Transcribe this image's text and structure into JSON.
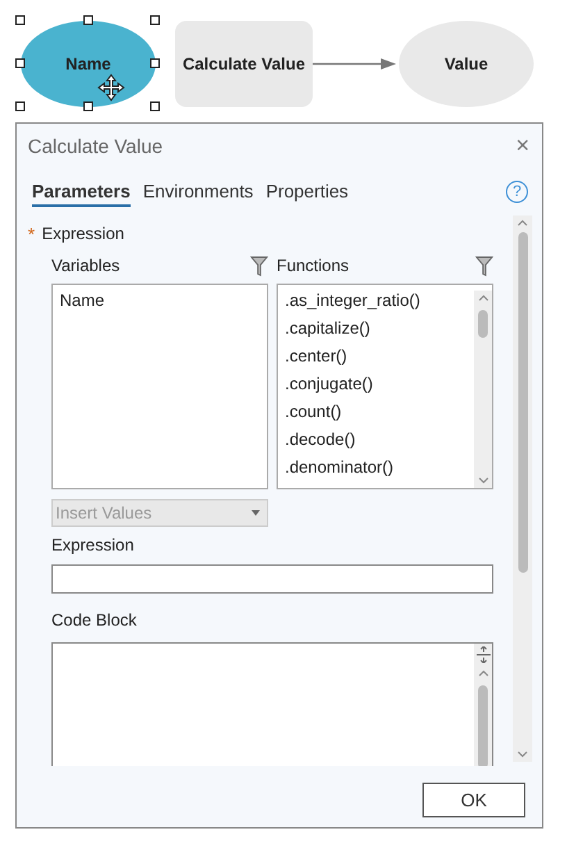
{
  "diagram": {
    "nodes": [
      {
        "kind": "variable",
        "label": "Name",
        "selected": true
      },
      {
        "kind": "tool",
        "label": "Calculate Value",
        "selected": false
      },
      {
        "kind": "variable",
        "label": "Value",
        "selected": false
      }
    ]
  },
  "dialog": {
    "title": "Calculate Value",
    "close": "×",
    "tabs": [
      {
        "label": "Parameters",
        "selected": true
      },
      {
        "label": "Environments",
        "selected": false
      },
      {
        "label": "Properties",
        "selected": false
      }
    ],
    "help": "?",
    "expression_param": {
      "label": "Expression",
      "required": true,
      "required_mark": "*"
    },
    "variables": {
      "label": "Variables",
      "items": [
        "Name"
      ]
    },
    "functions": {
      "label": "Functions",
      "items": [
        ".as_integer_ratio()",
        ".capitalize()",
        ".center()",
        ".conjugate()",
        ".count()",
        ".decode()",
        ".denominator()"
      ]
    },
    "insert_values": {
      "placeholder": "Insert Values",
      "disabled": true
    },
    "expression_field": {
      "label": "Expression"
    },
    "code_block": {
      "label": "Code Block"
    },
    "ok_button": "OK"
  }
}
